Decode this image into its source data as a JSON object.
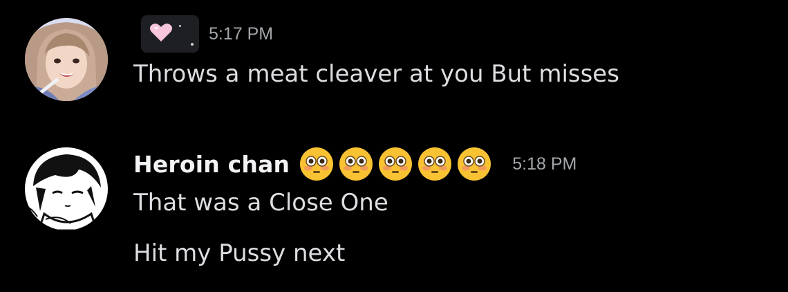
{
  "messages": [
    {
      "author": "",
      "timestamp": "5:17 PM",
      "lines": [
        "Throws a meat cleaver at you But misses"
      ],
      "avatar_icon": "anime-girl-avatar-icon",
      "badge_icon": "pink-heart-icon"
    },
    {
      "author": "Heroin chan",
      "timestamp": "5:18 PM",
      "lines": [
        "That was a Close One",
        "Hit my Pussy next"
      ],
      "avatar_icon": "manga-boy-avatar-icon",
      "name_emojis": [
        "flushed-face-emoji",
        "flushed-face-emoji",
        "flushed-face-emoji",
        "flushed-face-emoji",
        "flushed-face-emoji"
      ]
    }
  ],
  "colors": {
    "background": "#000000",
    "username": "#f2f3f5",
    "message_text": "#dcdee1",
    "timestamp": "#a3a6aa",
    "tag_background": "#1e1f22",
    "heart": "#f7c6dc"
  }
}
